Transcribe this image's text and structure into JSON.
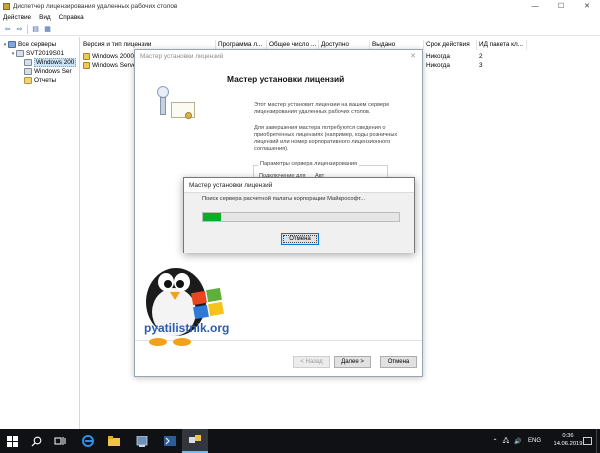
{
  "window": {
    "title": "Диспетчер лицензирования удаленных рабочих столов",
    "controls": [
      "—",
      "☐",
      "✕"
    ]
  },
  "menu": [
    "Действие",
    "Вид",
    "Справка"
  ],
  "toolbar": [
    "back-icon",
    "forward-icon",
    "refresh-icon",
    "view-icon"
  ],
  "tree": {
    "root": "Все серверы",
    "server": "SVT2019S01",
    "children": [
      "Windows 200",
      "Windows Ser",
      "Отчеты"
    ]
  },
  "list": {
    "columns": [
      "Версия и тип лицензии",
      "Программа л...",
      "Общее число ...",
      "Доступно",
      "Выдано",
      "Срок действия",
      "ИД пакета кл..."
    ],
    "rows": [
      {
        "name": "Windows 2000",
        "expires": "Никогда",
        "id": "2"
      },
      {
        "name": "Windows Serve",
        "expires": "Никогда",
        "id": "3"
      }
    ]
  },
  "wizard": {
    "title": "Мастер установки лицензий",
    "close": "✕",
    "heading": "Мастер установки лицензий",
    "para1": "Этот мастер установит лицензии на вашем сервере лицензирования удаленных рабочих столов.",
    "para2": "Для завершения мастера потребуются сведения о приобретенных лицензиях (например, коды розничных лицензий или номер корпоративного лицензионного соглашения).",
    "legend": "Параметры сервера лицензирования",
    "field_label": "Подключение для",
    "field_value": "Авт",
    "buttons": {
      "back": "< Назад",
      "next": "Далее >",
      "cancel": "Отмена"
    }
  },
  "logo": {
    "text": "pyatilistnik.org"
  },
  "progress": {
    "title": "Мастер установки лицензий",
    "message": "Поиск сервера расчетной палаты корпорации Майкрософт...",
    "fraction": 0.09,
    "cancel": "Отмена",
    "fill_color": "#06b025"
  },
  "taskbar": {
    "lang": "ENG",
    "time": "0:36",
    "date": "14.06.2019",
    "icons": [
      "windows-start-icon",
      "search-icon",
      "task-view-icon",
      "edge-icon",
      "file-explorer-icon",
      "server-manager-icon",
      "license-manager-icon"
    ]
  }
}
